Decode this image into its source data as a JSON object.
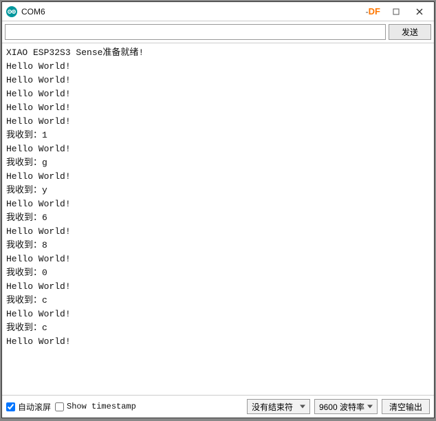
{
  "window": {
    "title": "COM6",
    "brand": "DF"
  },
  "toolbar": {
    "send_label": "发送",
    "input_value": "",
    "input_placeholder": ""
  },
  "output_lines": [
    "XIAO ESP32S3 Sense准备就绪!",
    "Hello World!",
    "Hello World!",
    "Hello World!",
    "Hello World!",
    "Hello World!",
    "我收到：1",
    "Hello World!",
    "我收到：g",
    "Hello World!",
    "我收到：y",
    "Hello World!",
    "我收到：6",
    "Hello World!",
    "我收到：8",
    "Hello World!",
    "我收到：0",
    "Hello World!",
    "我收到：c",
    "Hello World!",
    "我收到：c",
    "Hello World!"
  ],
  "footer": {
    "autoscroll_label": "自动滚屏",
    "autoscroll_checked": true,
    "timestamp_label": "Show timestamp",
    "timestamp_checked": false,
    "line_ending_selected": "没有结束符",
    "baud_selected": "9600 波特率",
    "clear_label": "清空输出"
  }
}
